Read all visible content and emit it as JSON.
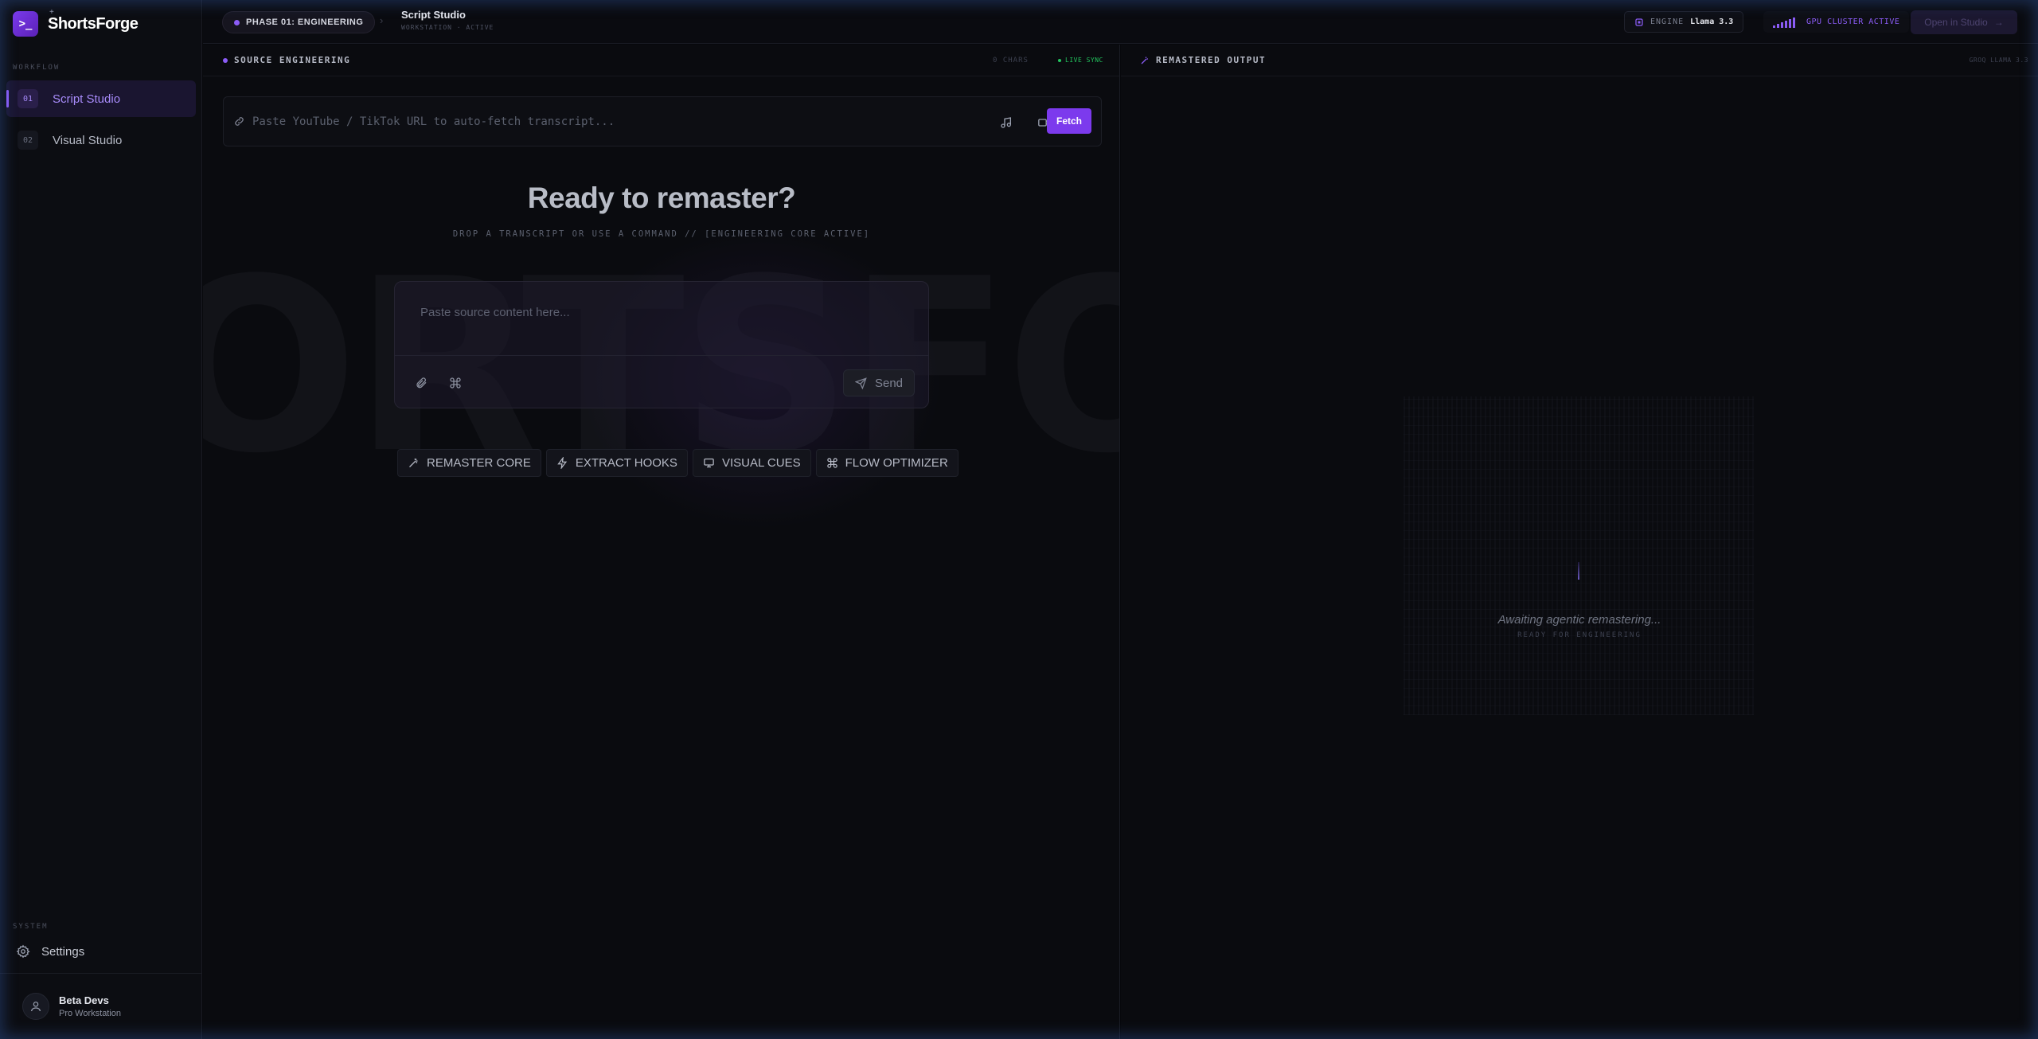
{
  "brand": {
    "name": "ShortsForge",
    "logo_glyph": ">_"
  },
  "sidebar": {
    "workflow_label": "WORKFLOW",
    "items": [
      {
        "num": "01",
        "label": "Script Studio",
        "active": true
      },
      {
        "num": "02",
        "label": "Visual Studio",
        "active": false
      }
    ],
    "system_label": "SYSTEM",
    "settings_label": "Settings",
    "user": {
      "name": "Beta Devs",
      "role": "Pro Workstation"
    }
  },
  "topbar": {
    "phase": "PHASE 01: ENGINEERING",
    "crumb_title": "Script Studio",
    "crumb_sub": "WORKSTATION · ACTIVE",
    "engine_label": "ENGINE",
    "engine_value": "Llama 3.3",
    "gpu_status": "GPU CLUSTER ACTIVE",
    "open_button": "Open in Studio"
  },
  "source": {
    "title": "SOURCE ENGINEERING",
    "chars": "0 CHARS",
    "sync": "LIVE SYNC",
    "url_placeholder": "Paste YouTube / TikTok URL to auto-fetch transcript...",
    "fetch_label": "Fetch",
    "watermark": "ORTSFOR",
    "hero_title": "Ready to remaster?",
    "hero_sub": "DROP A TRANSCRIPT OR USE A COMMAND // [ENGINEERING CORE ACTIVE]",
    "composer_placeholder": "Paste source content here...",
    "send_label": "Send",
    "actions": [
      "REMASTER CORE",
      "EXTRACT HOOKS",
      "VISUAL CUES",
      "FLOW OPTIMIZER"
    ]
  },
  "output": {
    "title": "REMASTERED OUTPUT",
    "badge": "GROQ LLAMA 3.3",
    "awaiting": "Awaiting agentic remastering...",
    "ready": "READY FOR ENGINEERING"
  },
  "colors": {
    "accent": "#7c3aed",
    "accent_light": "#a78bfa",
    "sync_green": "#22c55e"
  }
}
